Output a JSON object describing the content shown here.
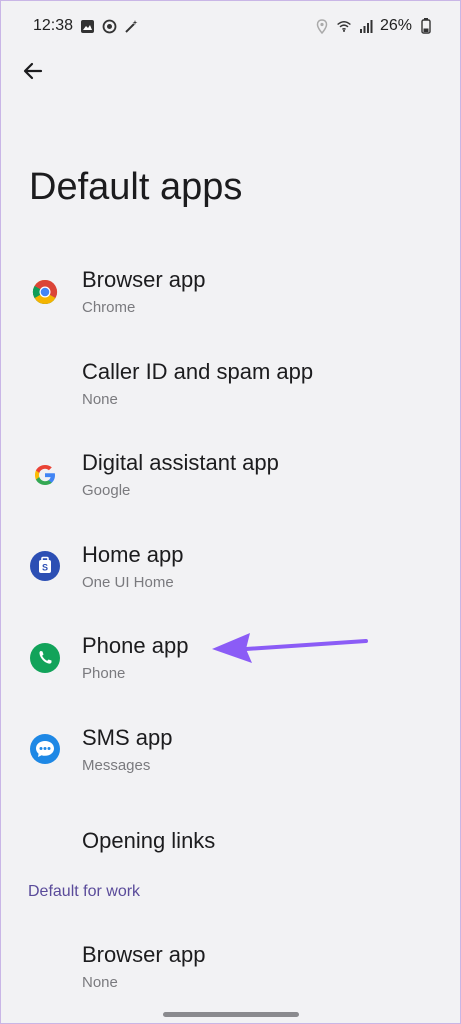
{
  "status_bar": {
    "time": "12:38",
    "battery": "26%",
    "left_icons": [
      "image-icon",
      "screen-record-icon",
      "magic-wand-icon"
    ],
    "right_icons": [
      "location-icon",
      "wifi-icon",
      "signal-icon",
      "battery-icon"
    ]
  },
  "header": {
    "back_icon": "back-arrow-icon",
    "title": "Default apps"
  },
  "items": [
    {
      "title": "Browser app",
      "subtitle": "Chrome",
      "icon": "chrome-icon"
    },
    {
      "title": "Caller ID and spam app",
      "subtitle": "None",
      "icon": ""
    },
    {
      "title": "Digital assistant app",
      "subtitle": "Google",
      "icon": "google-icon"
    },
    {
      "title": "Home app",
      "subtitle": "One UI Home",
      "icon": "one-ui-home-icon"
    },
    {
      "title": "Phone app",
      "subtitle": "Phone",
      "icon": "phone-icon"
    },
    {
      "title": "SMS app",
      "subtitle": "Messages",
      "icon": "messages-icon"
    },
    {
      "title": "Opening links",
      "subtitle": "",
      "icon": ""
    }
  ],
  "work_section": {
    "header": "Default for work",
    "item": {
      "title": "Browser app",
      "subtitle": "None"
    }
  },
  "colors": {
    "background": "#f2f2f4",
    "accent_arrow": "#8b5cf6",
    "section_header": "#5a4b9a"
  }
}
